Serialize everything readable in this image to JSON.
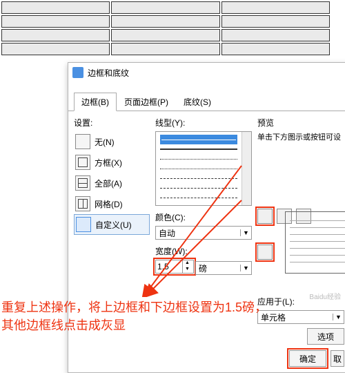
{
  "dialog": {
    "title": "边框和底纹",
    "tabs": {
      "borders": "边框(B)",
      "page": "页面边框(P)",
      "shading": "底纹(S)"
    },
    "settings": {
      "label": "设置:",
      "none": "无(N)",
      "box": "方框(X)",
      "all": "全部(A)",
      "grid": "网格(D)",
      "custom": "自定义(U)"
    },
    "style": {
      "label": "线型(Y):"
    },
    "color": {
      "label": "颜色(C):",
      "value": "自动"
    },
    "width": {
      "label": "宽度(W):",
      "value": "1.5",
      "unit": "磅"
    },
    "preview": {
      "label": "预览",
      "hint": "单击下方图示或按钮可设"
    },
    "apply": {
      "label": "应用于(L):",
      "value": "单元格"
    },
    "options": "选项",
    "ok": "确定",
    "cancel": "取"
  },
  "annotation": {
    "line1": "重复上述操作，将上边框和下边框设置为1.5磅，",
    "line2": "其他边框线点击成灰显"
  },
  "watermark": "Baidu经验"
}
